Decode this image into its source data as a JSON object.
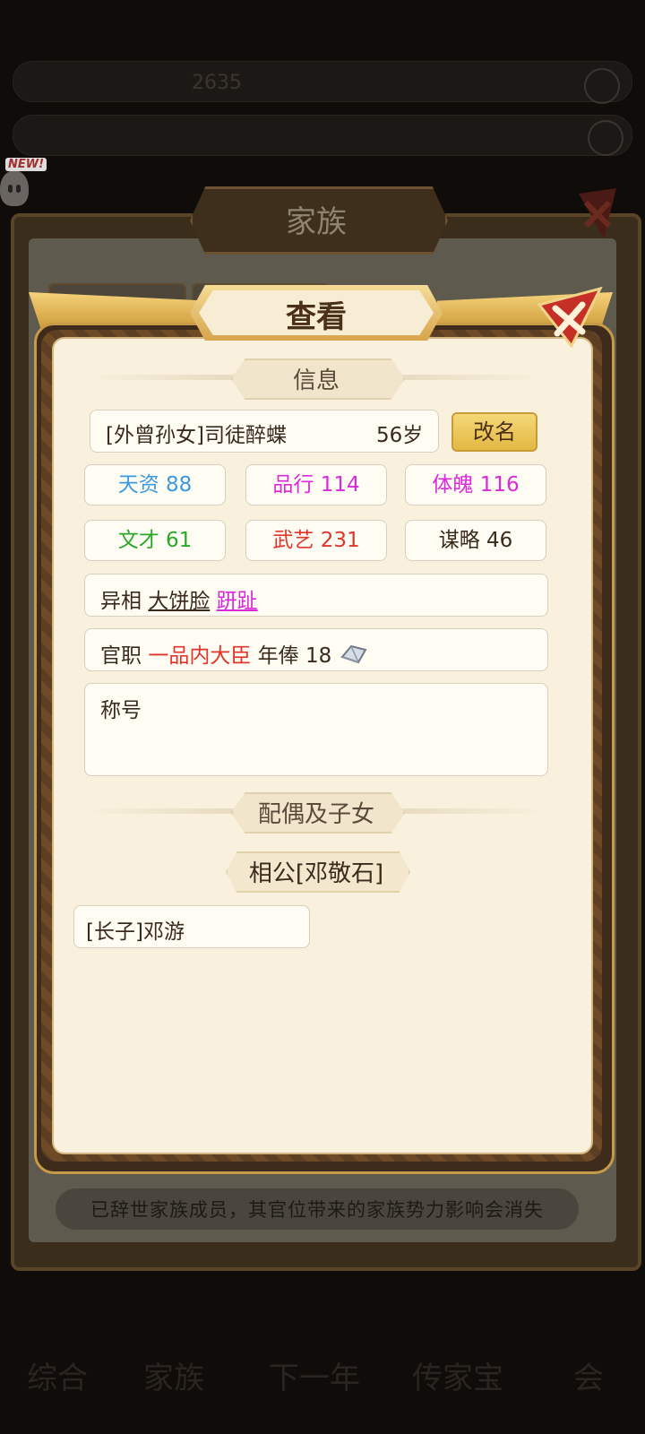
{
  "background": {
    "top_bar_1": [
      "",
      "2635",
      ""
    ],
    "bottom_nav": [
      "综合",
      "家族",
      "下一年",
      "传家宝",
      "会"
    ]
  },
  "new_badge": "NEW!",
  "back_dialog": {
    "title": "家族",
    "hint": "已辞世家族成员，其官位带来的家族势力影响会消失"
  },
  "dialog": {
    "title": "查看",
    "info_section": "信息",
    "name": "[外曾孙女]司徒醉蝶",
    "age": "56岁",
    "rename_label": "改名",
    "stats": [
      {
        "label": "天资 88",
        "color": "#3b9ae0"
      },
      {
        "label": "品行 114",
        "color": "#d92ad9"
      },
      {
        "label": "体魄 116",
        "color": "#d92ad9"
      },
      {
        "label": "文才 61",
        "color": "#2aa82a"
      },
      {
        "label": "武艺 231",
        "color": "#e0352a"
      },
      {
        "label": "谋略 46",
        "color": "#3a2a1c"
      }
    ],
    "traits": {
      "label": "异相",
      "trait_1": "大饼脸",
      "trait_2": "趼趾",
      "trait_2_color": "#d92ad9"
    },
    "office": {
      "label": "官职",
      "rank": "一品内大臣",
      "rank_color": "#e0352a",
      "salary_label": "年俸",
      "salary_value": "18",
      "salary_icon": "silver-ingot-icon"
    },
    "title_field": {
      "label": "称号",
      "value": ""
    },
    "family_section": "配偶及子女",
    "spouse": "相公[邓敬石]",
    "children": [
      "[长子]邓游"
    ]
  }
}
